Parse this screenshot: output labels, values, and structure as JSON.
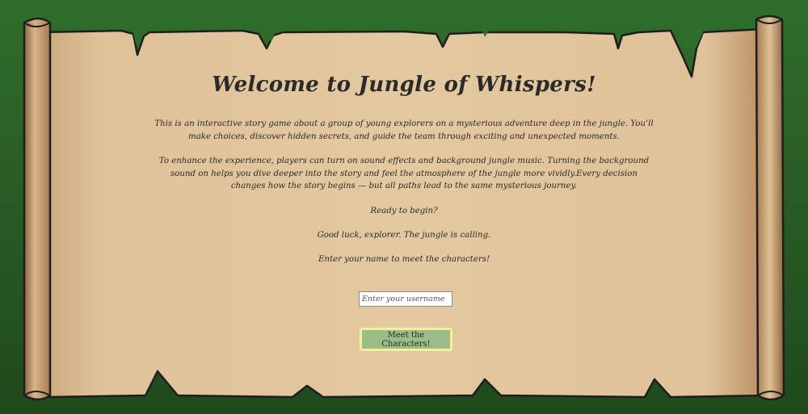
{
  "welcome": {
    "title": "Welcome to Jungle of Whispers!",
    "intro": "This is an interactive story game about a group of young explorers on a mysterious adventure deep in the jungle. You’ll make choices, discover hidden secrets, and guide the team through exciting and unexpected moments.",
    "sound_info": "To enhance the experience, players can turn on sound effects and background jungle music. Turning the background sound on helps you dive deeper into the story and feel the atmosphere of the jungle more vividly.Every decision changes how the story begins — but all paths lead to the same mysterious journey.",
    "ready": "Ready to begin?",
    "good_luck": "Good luck, explorer. The jungle is calling.",
    "enter_name": "Enter your name to meet the characters!"
  },
  "form": {
    "username_placeholder": "Enter your username",
    "username_value": "",
    "submit_label": "Meet the Characters!"
  },
  "colors": {
    "background": "#2f6e2a",
    "parchment": "#e2c49c",
    "button": "#9bbe88",
    "button_border": "#f3ef9a",
    "text": "#2a2a2a"
  }
}
